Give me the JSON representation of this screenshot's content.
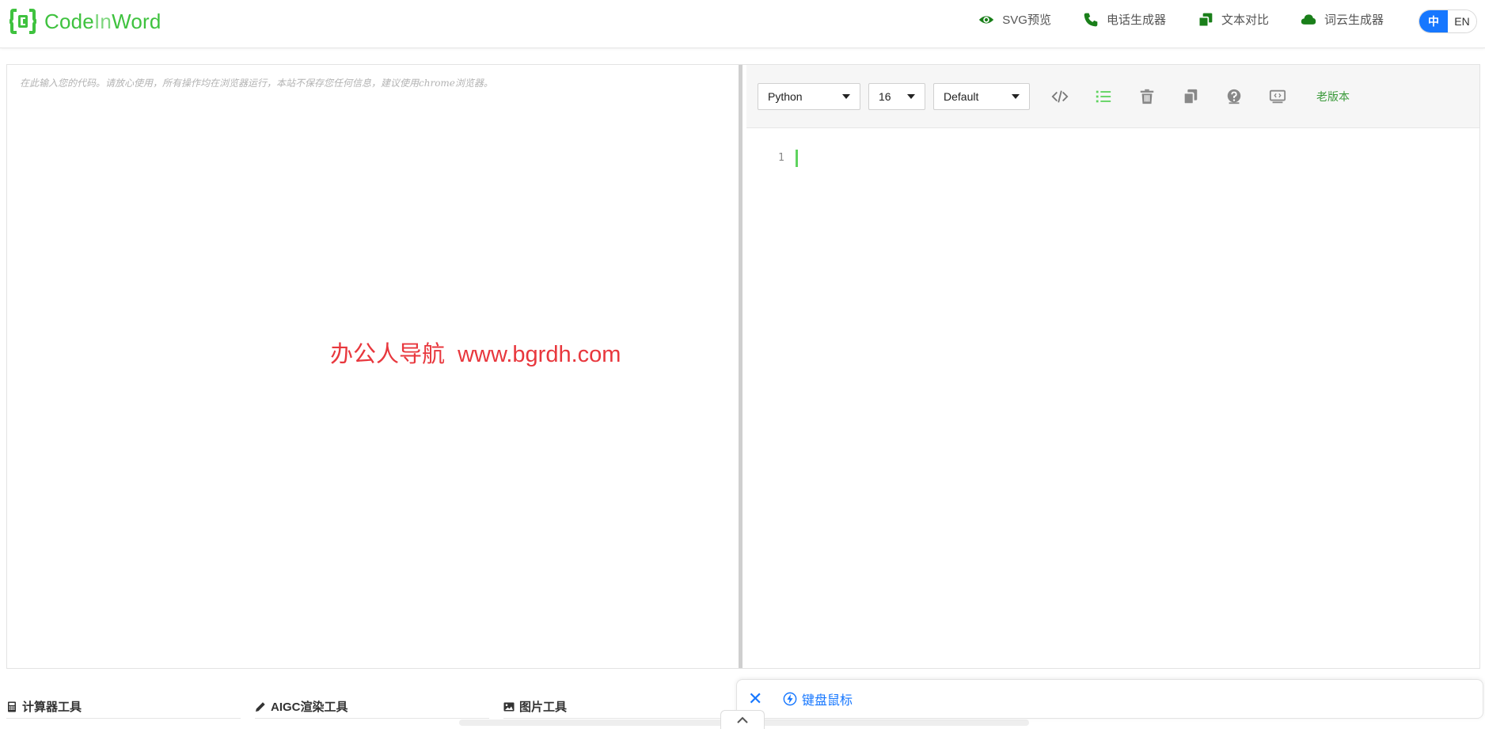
{
  "header": {
    "logo": {
      "text_a": "Code",
      "text_b": "In",
      "text_c": "Word",
      "icon": "code-brackets-logo"
    },
    "nav": [
      {
        "label": "SVG预览",
        "icon": "eye-icon"
      },
      {
        "label": "电话生成器",
        "icon": "phone-icon"
      },
      {
        "label": "文本对比",
        "icon": "copy-compare-icon"
      },
      {
        "label": "词云生成器",
        "icon": "cloud-icon"
      }
    ],
    "lang": {
      "zh": "中",
      "en": "EN",
      "active": "zh"
    }
  },
  "editor": {
    "placeholder": "在此输入您的代码。请放心使用，所有操作均在浏览器运行，本站不保存您任何信息，建议使用chrome浏览器。",
    "watermark": "办公人导航  www.bgrdh.com"
  },
  "toolbar": {
    "language": "Python",
    "font_size": "16",
    "theme": "Default",
    "icons": [
      "code-icon",
      "line-numbers-icon",
      "trash-icon",
      "copy-icon",
      "help-icon",
      "screen-icon"
    ],
    "old_version": "老版本"
  },
  "output": {
    "line_number": "1"
  },
  "bottom": {
    "tabs": [
      {
        "label": "计算器工具",
        "icon": "calculator-icon"
      },
      {
        "label": "AIGC渲染工具",
        "icon": "pencil-icon"
      },
      {
        "label": "图片工具",
        "icon": "image-icon"
      }
    ],
    "keyboard_bar": {
      "close": "✕",
      "label": "键盘鼠标",
      "icon": "lightning-icon"
    }
  },
  "colors": {
    "brand_green": "#3fc23f",
    "nav_icon_green": "#1a7f1a",
    "accent_blue": "#1677ff",
    "watermark_red": "#e8373d"
  }
}
